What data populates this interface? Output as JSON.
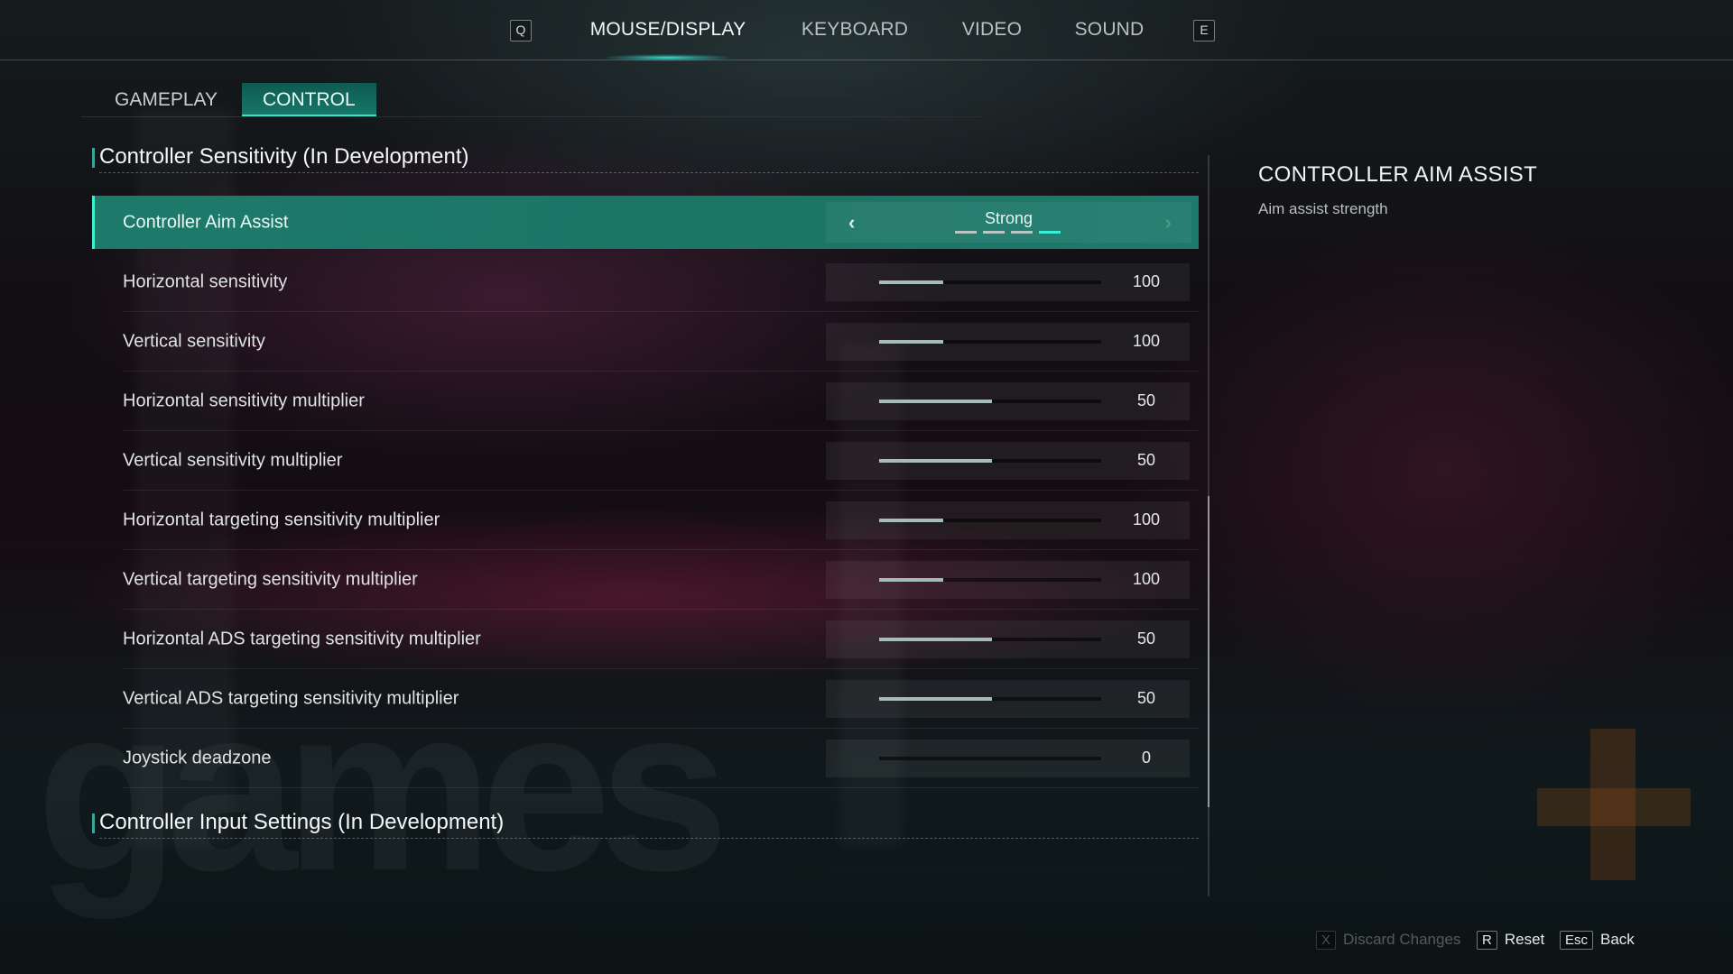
{
  "top_nav": {
    "prev_key": "Q",
    "next_key": "E",
    "tabs": [
      {
        "label": "MOUSE/DISPLAY",
        "active": true
      },
      {
        "label": "KEYBOARD",
        "active": false
      },
      {
        "label": "VIDEO",
        "active": false
      },
      {
        "label": "SOUND",
        "active": false
      }
    ]
  },
  "sub_tabs": [
    {
      "label": "GAMEPLAY",
      "active": false
    },
    {
      "label": "CONTROL",
      "active": true
    }
  ],
  "sections": [
    {
      "title": "Controller Sensitivity (In Development)",
      "selector": {
        "label": "Controller Aim Assist",
        "value": "Strong",
        "option_count": 4,
        "selected_index": 3,
        "left_arrow": "‹",
        "right_arrow": "›"
      },
      "sliders": [
        {
          "label": "Horizontal sensitivity",
          "value": "100",
          "fill_fraction": 0.29
        },
        {
          "label": "Vertical sensitivity",
          "value": "100",
          "fill_fraction": 0.29
        },
        {
          "label": "Horizontal sensitivity multiplier",
          "value": "50",
          "fill_fraction": 0.51
        },
        {
          "label": "Vertical sensitivity multiplier",
          "value": "50",
          "fill_fraction": 0.51
        },
        {
          "label": "Horizontal targeting sensitivity multiplier",
          "value": "100",
          "fill_fraction": 0.29
        },
        {
          "label": "Vertical targeting sensitivity multiplier",
          "value": "100",
          "fill_fraction": 0.29
        },
        {
          "label": "Horizontal ADS targeting sensitivity multiplier",
          "value": "50",
          "fill_fraction": 0.51
        },
        {
          "label": "Vertical ADS targeting sensitivity multiplier",
          "value": "50",
          "fill_fraction": 0.51
        },
        {
          "label": "Joystick deadzone",
          "value": "0",
          "fill_fraction": 0.0
        }
      ]
    },
    {
      "title": "Controller Input Settings (In Development)"
    }
  ],
  "scrollbar": {
    "thumb_start_fraction": 0.46,
    "thumb_size_fraction": 0.42
  },
  "description": {
    "title": "CONTROLLER AIM ASSIST",
    "text": "Aim assist strength"
  },
  "footer": {
    "discard": {
      "key": "X",
      "label": "Discard Changes",
      "enabled": false
    },
    "reset": {
      "key": "R",
      "label": "Reset",
      "enabled": true
    },
    "back": {
      "key": "Esc",
      "label": "Back",
      "enabled": true
    }
  },
  "watermark": "games",
  "colors": {
    "accent": "#3ef0d2",
    "selected_row": "#1d7a6b",
    "slider_fill": "#a7bcb9"
  }
}
